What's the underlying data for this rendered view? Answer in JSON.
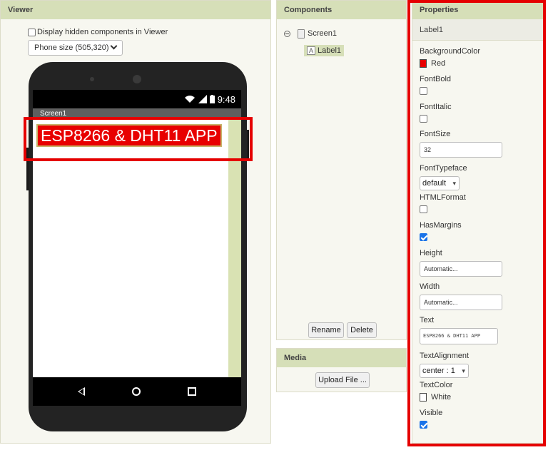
{
  "viewer": {
    "title": "Viewer",
    "show_hidden_label": "Display hidden components in Viewer",
    "size_select": "Phone size (505,320)",
    "phone": {
      "time": "9:48",
      "screen_title": "Screen1",
      "label_text": "ESP8266 & DHT11 APP"
    }
  },
  "components": {
    "title": "Components",
    "tree": {
      "screen": "Screen1",
      "label": "Label1"
    },
    "rename_label": "Rename",
    "delete_label": "Delete"
  },
  "media": {
    "title": "Media",
    "upload_label": "Upload File ..."
  },
  "properties": {
    "title": "Properties",
    "component": "Label1",
    "background_color": {
      "label": "BackgroundColor",
      "value": "Red",
      "color": "#e80000"
    },
    "font_bold": {
      "label": "FontBold",
      "checked": false
    },
    "font_italic": {
      "label": "FontItalic",
      "checked": false
    },
    "font_size": {
      "label": "FontSize",
      "value": "32"
    },
    "font_typeface": {
      "label": "FontTypeface",
      "value": "default"
    },
    "html_format": {
      "label": "HTMLFormat",
      "checked": false
    },
    "has_margins": {
      "label": "HasMargins",
      "checked": true
    },
    "height": {
      "label": "Height",
      "value": "Automatic..."
    },
    "width": {
      "label": "Width",
      "value": "Automatic..."
    },
    "text": {
      "label": "Text",
      "value": "ESP8266 & DHT11 APP"
    },
    "text_alignment": {
      "label": "TextAlignment",
      "value": "center : 1"
    },
    "text_color": {
      "label": "TextColor",
      "value": "White",
      "color": "#ffffff"
    },
    "visible": {
      "label": "Visible",
      "checked": true
    }
  },
  "colors": {
    "header_bg": "#d6dfb8",
    "highlight": "#e50000",
    "checkbox_accent": "#1a73e8"
  }
}
